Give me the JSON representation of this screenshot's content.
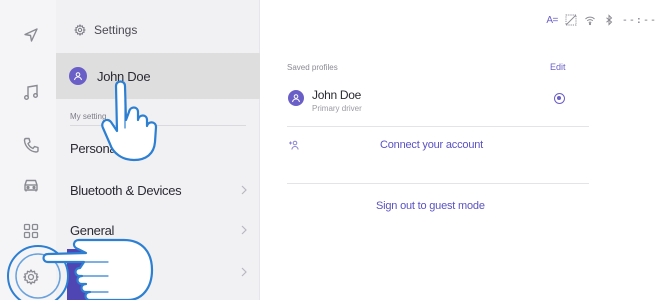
{
  "rail": {
    "icons": [
      "navigation-icon",
      "music-icon",
      "phone-icon",
      "car-icon",
      "apps-grid-icon",
      "settings-gear-icon"
    ]
  },
  "settings": {
    "header_title": "Settings",
    "profile_name": "John Doe",
    "section_label": "My setting",
    "menu_items": [
      {
        "label": "Personal"
      },
      {
        "label": "Bluetooth & Devices"
      },
      {
        "label": "General"
      }
    ]
  },
  "main": {
    "status_text": "A=",
    "time": "--:--",
    "saved_profiles_label": "Saved profiles",
    "edit_label": "Edit",
    "saved_profile": {
      "name": "John Doe",
      "role": "Primary driver",
      "selected": true
    },
    "connect_account_label": "Connect your account",
    "sign_out_label": "Sign out to guest mode"
  },
  "colors": {
    "accent": "#6a5fc7",
    "accent_dark": "#4f46b4",
    "selected_row": "#dededf",
    "rail_bg": "#f5f5f7",
    "settings_bg": "#f1f1f4",
    "highlight_ring": "#2d7fd2"
  },
  "overlay": {
    "hands": [
      "pointing-hand-icon",
      "pointing-hand-icon"
    ],
    "highlight": "highlight-ring"
  }
}
